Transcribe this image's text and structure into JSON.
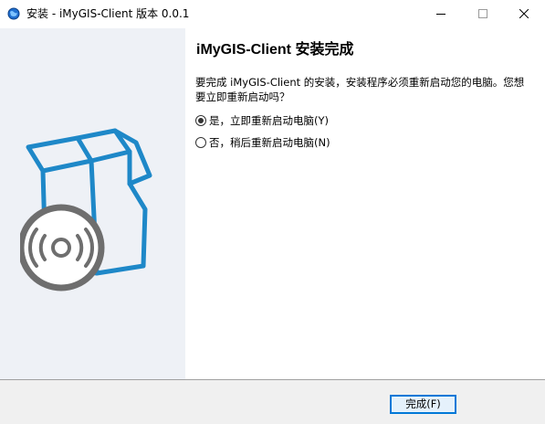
{
  "window": {
    "title": "安装 - iMyGIS-Client 版本 0.0.1",
    "icon": "installer-globe-icon"
  },
  "controls": {
    "minimize_icon": "minimize-icon",
    "maximize_icon": "maximize-icon",
    "close_icon": "close-icon"
  },
  "left_panel": {
    "art": "software-box-disc-icon",
    "colors": {
      "background": "#eef1f6",
      "box": "#1e88c8",
      "disc": "#6e6e6e"
    }
  },
  "content": {
    "heading": "iMyGIS-Client 安装完成",
    "description": "要完成 iMyGIS-Client 的安装，安装程序必须重新启动您的电脑。您想要立即重新启动吗？",
    "options": [
      {
        "label": "是，立即重新启动电脑(Y)",
        "selected": true
      },
      {
        "label": "否，稍后重新启动电脑(N)",
        "selected": false
      }
    ]
  },
  "footer": {
    "finish_label": "完成(F)",
    "accent": "#0078d7"
  }
}
